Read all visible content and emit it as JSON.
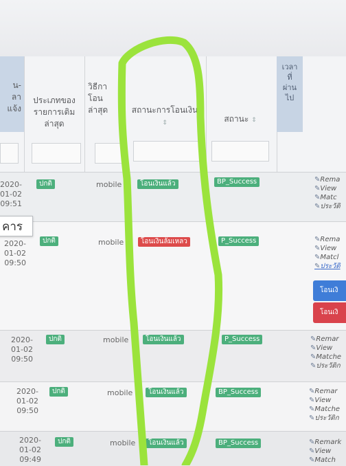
{
  "header": {
    "col_approve_lines": [
      "น-",
      "ลา",
      "แจ้ง"
    ],
    "col_last_topup_type": "ประเภทของรายการเติมล่าสุด",
    "col_last_transfer_method_lines": [
      "วิธีกา",
      "โอน",
      "ล่าสุด"
    ],
    "col_transfer_status": "สถานะการโอนเงิน",
    "col_status": "สถานะ",
    "col_elapsed_lines": [
      "เวลา",
      "ที่",
      "ผ่าน",
      "ไป"
    ]
  },
  "popup_text": "คาร",
  "rows": [
    {
      "date": [
        "2020-",
        "01-02",
        "09:51"
      ],
      "topup": "ปกติ",
      "method": "mobile",
      "transfer_status": "โอนเงินแล้ว",
      "status": "BP_Success"
    },
    {
      "date": [
        "2020-",
        "01-02",
        "09:50"
      ],
      "topup": "ปกติ",
      "method": "mobile",
      "transfer_status": "โอนเงินล้มเหลว",
      "status": "P_Success"
    },
    {
      "date": [
        "2020-",
        "01-02",
        "09:50"
      ],
      "topup": "ปกติ",
      "method": "mobile",
      "transfer_status": "โอนเงินแล้ว",
      "status": "P_Success"
    },
    {
      "date": [
        "2020-",
        "01-02",
        "09:50"
      ],
      "topup": "ปกติ",
      "method": "mobile",
      "transfer_status": "โอนเงินแล้ว",
      "status": "BP_Success"
    },
    {
      "date": [
        "2020-",
        "01-02",
        "09:49"
      ],
      "topup": "ปกติ",
      "method": "mobile",
      "transfer_status": "โอนเงินแล้ว",
      "status": "BP_Success"
    }
  ],
  "actions": {
    "r1": [
      "Rema",
      "View",
      "Matc",
      "ประวัติ"
    ],
    "r2": [
      "Rema",
      "View",
      "Matcl",
      "ประวัติ"
    ],
    "r3": [
      "Remar",
      "View",
      "Matche",
      "ประวัติก"
    ],
    "r4": [
      "Remar",
      "View",
      "Matche",
      "ประวัติก"
    ],
    "r5": [
      "Remark",
      "View",
      "Match"
    ]
  },
  "buttons": {
    "blue": "โอนเงิ",
    "red": "โอนเงิ"
  },
  "colors": {
    "success": "#4caf7c",
    "danger": "#dd4b4b",
    "scribble": "#9be33c"
  }
}
